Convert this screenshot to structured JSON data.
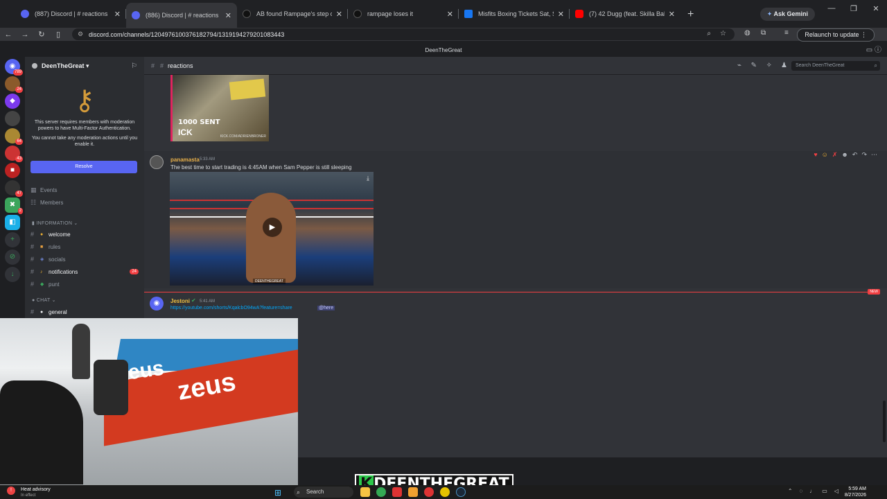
{
  "browser": {
    "tabs": [
      {
        "title": "(887) Discord | # reactions",
        "favicon_color": "#5865f2",
        "active": false
      },
      {
        "title": "(886) Discord | # reactions",
        "favicon_color": "#5865f2",
        "active": true
      },
      {
        "title": "AB found Rampage's step dua",
        "favicon_color": "#111111",
        "active": false
      },
      {
        "title": "rampage loses it",
        "favicon_color": "#111111",
        "active": false
      },
      {
        "title": "Misfits Boxing Tickets Sat, Sep",
        "favicon_color": "#1877f2",
        "active": false
      },
      {
        "title": "(7) 42 Dugg (feat. Skilla Baby)",
        "favicon_color": "#ff0000",
        "active": false
      }
    ],
    "gemini_label": "Ask Gemini",
    "url": "discord.com/channels/1204976100376182794/1319194279201083443",
    "relaunch_label": "Relaunch to update"
  },
  "discord": {
    "window_title": "DeenTheGreat",
    "server_name": "DeenTheGreat",
    "guild_badges": [
      "789",
      "24",
      "",
      "",
      "64",
      "43",
      "",
      "47",
      "2"
    ],
    "mfa": {
      "line1": "This server requires members with moderation powers to have Multi-Factor Authentication.",
      "line2": "You cannot take any moderation actions until you enable it.",
      "button": "Resolve"
    },
    "nav_items": {
      "events": "Events",
      "members": "Members"
    },
    "categories": {
      "information": "INFORMATION",
      "chat": "CHAT"
    },
    "channels": [
      {
        "name": "welcome",
        "bright": true,
        "count": ""
      },
      {
        "name": "rules",
        "bright": false,
        "count": ""
      },
      {
        "name": "socials",
        "bright": false,
        "count": ""
      },
      {
        "name": "notifications",
        "bright": true,
        "count": "24"
      },
      {
        "name": "punt",
        "bright": false,
        "count": ""
      },
      {
        "name": "general",
        "bright": true,
        "count": ""
      }
    ],
    "channel_header": "reactions",
    "search_placeholder": "Search DeenTheGreat",
    "image1": {
      "text1": "1000 SENT",
      "text2": "ICK",
      "watermark": "KICK.COM/ADRIENBRONER"
    },
    "messages": [
      {
        "user": "panamasta",
        "user_color": "#e8b04a",
        "time": "5:33 AM",
        "text": "The best time to start trading is 4:45AM when Sam Pepper is still sleeping",
        "video_watermark": "DEENTHEGREAT"
      },
      {
        "user": "Jestoni",
        "user_color": "#f0c040",
        "time": "5:41 AM",
        "link": "https://youtube.com/shorts/KqalcbO94wA?feature=share",
        "mention": "@here"
      }
    ],
    "new_tag": "NEW"
  },
  "stream_overlay": {
    "k": "K",
    "name": "DEENTHEGREAT"
  },
  "taskbar": {
    "weather_title": "Heat advisory",
    "weather_sub": "In effect",
    "search": "Search",
    "time": "5:59 AM",
    "date": "8/27/2026"
  }
}
